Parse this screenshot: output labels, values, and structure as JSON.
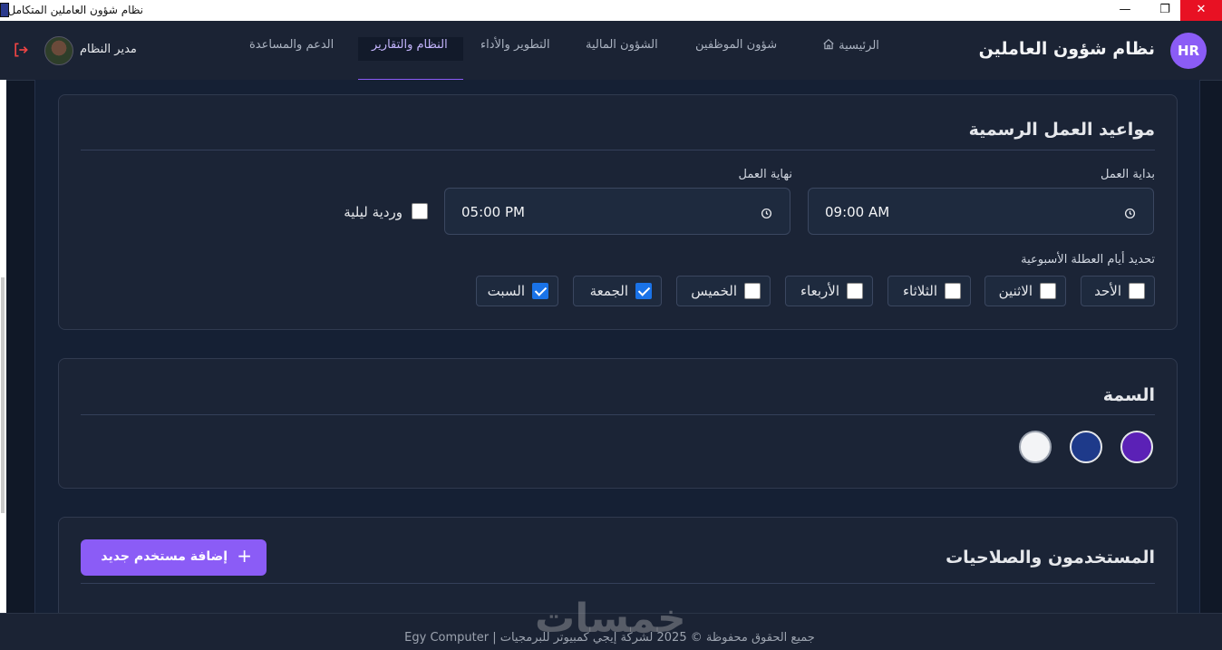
{
  "window": {
    "title": "نظام شؤون العاملين المتكامل",
    "min_glyph": "—",
    "max_glyph": "❐",
    "close_glyph": "✕"
  },
  "header": {
    "badge": "HR",
    "title": "نظام شؤون العاملين",
    "nav": [
      {
        "label": "الرئيسية",
        "icon": "home-icon"
      },
      {
        "label": "شؤون الموظفين"
      },
      {
        "label": "الشؤون المالية"
      },
      {
        "label": "التطوير والأداء"
      },
      {
        "label": "النظام والتقارير",
        "active": true
      },
      {
        "label": "الدعم والمساعدة"
      }
    ],
    "user_name": "مدير النظام",
    "accent": "#8b5cf6"
  },
  "work_hours": {
    "title": "مواعيد العمل الرسمية",
    "start_label": "بداية العمل",
    "start_value": "09:00 AM",
    "end_label": "نهاية العمل",
    "end_value": "05:00 PM",
    "night_shift_label": "وردية ليلية",
    "night_shift_checked": false,
    "weekend_label": "تحديد أيام العطلة الأسبوعية",
    "days": [
      {
        "label": "الأحد",
        "checked": false
      },
      {
        "label": "الاثنين",
        "checked": false
      },
      {
        "label": "الثلاثاء",
        "checked": false
      },
      {
        "label": "الأربعاء",
        "checked": false
      },
      {
        "label": "الخميس",
        "checked": false
      },
      {
        "label": "الجمعة",
        "checked": true
      },
      {
        "label": "السبت",
        "checked": true
      }
    ]
  },
  "theme": {
    "title": "السمة",
    "swatches": [
      "#5b21b6",
      "#1e3a8a",
      "#f3f4f6"
    ]
  },
  "users": {
    "title": "المستخدمون والصلاحيات",
    "add_button": "إضافة مستخدم جديد"
  },
  "footer": {
    "text": "جميع الحقوق محفوظة © 2025 لشركة إيجي كمبيوتر للبرمجيات | Egy Computer"
  },
  "watermark": "خمسات"
}
